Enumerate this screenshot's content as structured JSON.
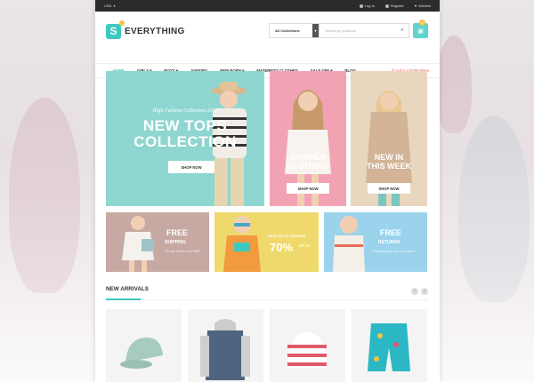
{
  "topbar": {
    "currency": "USD",
    "login": "Log In",
    "register": "Register",
    "wishlist": "Wishlist"
  },
  "header": {
    "logo_letter": "S",
    "logo_text": "EVERYTHING",
    "category_select": "All Collections",
    "search_placeholder": "Search by products",
    "cart_count": "0"
  },
  "nav": {
    "items": [
      "HOME",
      "GIRLS",
      "BOYS",
      "JUNIORS",
      "NEW BORN",
      "MATERNITY CLOTHES",
      "SALE OFF",
      "BLOG"
    ],
    "phone": "(+01) 123456789xx"
  },
  "hero": {
    "subtitle": "High Fashion Collection 2016",
    "title_line1": "NEW TOPS",
    "title_line2": "COLLECTION",
    "button": "SHOP NOW"
  },
  "tiles": [
    {
      "line1": "SUMMER",
      "line2": "CLOTHING",
      "button": "SHOP NOW"
    },
    {
      "line1": "NEW IN",
      "line2": "THIS WEEK",
      "button": "SHOP NOW"
    }
  ],
  "banners": [
    {
      "title1": "FREE",
      "title2": "SHIPPING",
      "text": "On all orders over $99"
    },
    {
      "small": "NEW STYLE FASHION",
      "big": "70%",
      "off": "UP TO"
    },
    {
      "title1": "FREE",
      "title2": "RETURNS",
      "text": "Returning is not a problem"
    }
  ],
  "section": {
    "title": "NEW ARRIVALS"
  },
  "colors": {
    "accent": "#3ec8c0",
    "hero_bg": "#8fd6d0",
    "tile_pink": "#f2a3b3",
    "tile_beige": "#e9d6be"
  }
}
